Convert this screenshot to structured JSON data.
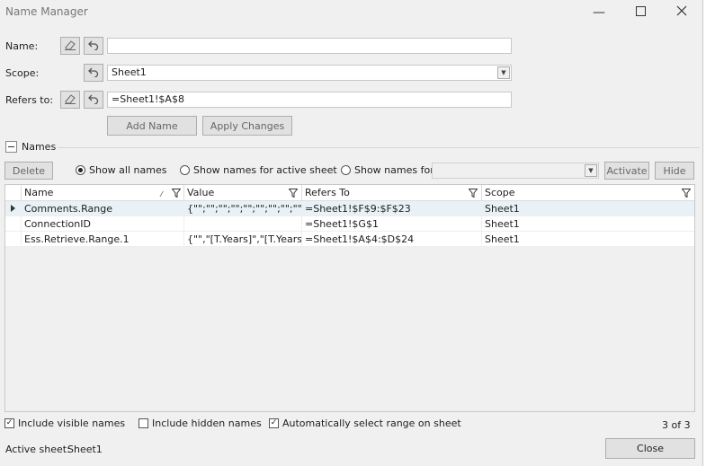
{
  "window": {
    "title": "Name Manager"
  },
  "form": {
    "name_label": "Name:",
    "name_value": "",
    "scope_label": "Scope:",
    "scope_value": "Sheet1",
    "refers_label": "Refers to:",
    "refers_value": "=Sheet1!$A$8",
    "add_name": "Add Name",
    "apply_changes": "Apply Changes"
  },
  "names_section": {
    "title": "Names"
  },
  "toolbar": {
    "delete": "Delete",
    "show_all": "Show all names",
    "show_active": "Show names for active sheet",
    "show_for": "Show names for:",
    "show_for_value": "",
    "activate": "Activate",
    "hide": "Hide"
  },
  "table": {
    "columns": [
      "Name",
      "Value",
      "Refers To",
      "Scope"
    ],
    "rows": [
      {
        "name": "Comments.Range",
        "value": "{\"\";\"\";\"\";\"\";\"\";\"\";\"\";\"\";\"\";\"\";\"\";\"\";...",
        "refers": "=Sheet1!$F$9:$F$23",
        "scope": "Sheet1"
      },
      {
        "name": "ConnectionID",
        "value": "",
        "refers": "=Sheet1!$G$1",
        "scope": "Sheet1"
      },
      {
        "name": "Ess.Retrieve.Range.1",
        "value": "{\"\",\"[T.Years]\",\"[T.Years...",
        "refers": "=Sheet1!$A$4:$D$24",
        "scope": "Sheet1"
      }
    ]
  },
  "options": {
    "include_visible": "Include visible names",
    "include_hidden": "Include hidden names",
    "auto_select": "Automatically select range on sheet",
    "count": "3 of 3"
  },
  "footer": {
    "active_sheet_label": "Active sheet:",
    "active_sheet_value": "Sheet1",
    "close": "Close"
  }
}
